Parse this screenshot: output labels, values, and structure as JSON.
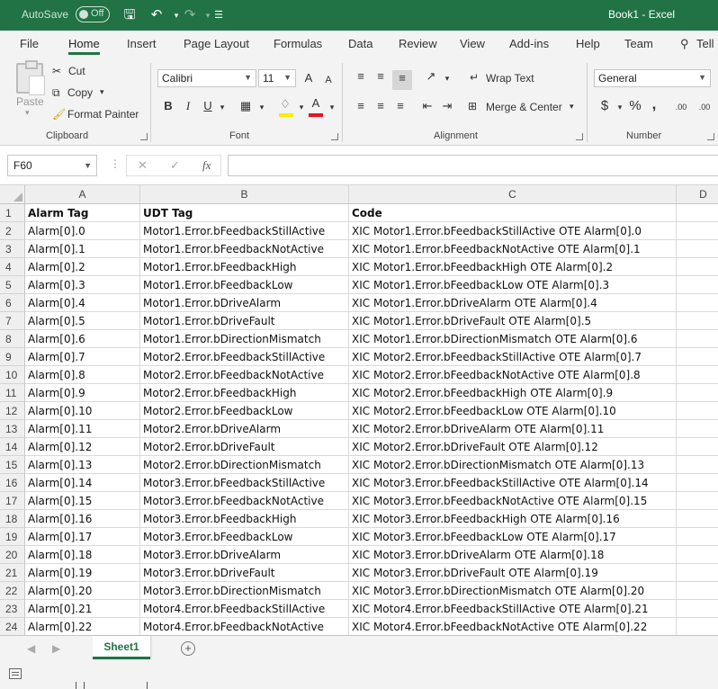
{
  "titlebar": {
    "autosave_label": "AutoSave",
    "autosave_state": "Off",
    "document_title": "Book1  -  Excel"
  },
  "tabs": [
    "File",
    "Home",
    "Insert",
    "Page Layout",
    "Formulas",
    "Data",
    "Review",
    "View",
    "Add-ins",
    "Help",
    "Team",
    "Tell"
  ],
  "active_tab": "Home",
  "ribbon": {
    "clipboard": {
      "paste": "Paste",
      "cut": "Cut",
      "copy": "Copy",
      "format_painter": "Format Painter",
      "group_label": "Clipboard"
    },
    "font": {
      "font_name": "Calibri",
      "font_size": "11",
      "grow": "A",
      "shrink": "A",
      "bold": "B",
      "italic": "I",
      "underline": "U",
      "group_label": "Font"
    },
    "alignment": {
      "wrap_text": "Wrap Text",
      "merge_center": "Merge & Center",
      "group_label": "Alignment"
    },
    "number": {
      "format": "General",
      "currency": "$",
      "percent": "%",
      "comma": ",",
      "inc_decimal": ".00",
      "dec_decimal": ".00",
      "group_label": "Number"
    }
  },
  "formula_bar": {
    "name_box": "F60",
    "fx": "fx",
    "formula": ""
  },
  "columns": [
    "A",
    "B",
    "C",
    "D"
  ],
  "rows": [
    {
      "num": "1",
      "a": "Alarm Tag",
      "b": "UDT Tag",
      "c": "Code"
    },
    {
      "num": "2",
      "a": "Alarm[0].0",
      "b": "Motor1.Error.bFeedbackStillActive",
      "c": "XIC Motor1.Error.bFeedbackStillActive OTE Alarm[0].0"
    },
    {
      "num": "3",
      "a": "Alarm[0].1",
      "b": "Motor1.Error.bFeedbackNotActive",
      "c": "XIC Motor1.Error.bFeedbackNotActive OTE Alarm[0].1"
    },
    {
      "num": "4",
      "a": "Alarm[0].2",
      "b": "Motor1.Error.bFeedbackHigh",
      "c": "XIC Motor1.Error.bFeedbackHigh OTE Alarm[0].2"
    },
    {
      "num": "5",
      "a": "Alarm[0].3",
      "b": "Motor1.Error.bFeedbackLow",
      "c": "XIC Motor1.Error.bFeedbackLow OTE Alarm[0].3"
    },
    {
      "num": "6",
      "a": "Alarm[0].4",
      "b": "Motor1.Error.bDriveAlarm",
      "c": "XIC Motor1.Error.bDriveAlarm OTE Alarm[0].4"
    },
    {
      "num": "7",
      "a": "Alarm[0].5",
      "b": "Motor1.Error.bDriveFault",
      "c": "XIC Motor1.Error.bDriveFault OTE Alarm[0].5"
    },
    {
      "num": "8",
      "a": "Alarm[0].6",
      "b": "Motor1.Error.bDirectionMismatch",
      "c": "XIC Motor1.Error.bDirectionMismatch OTE Alarm[0].6"
    },
    {
      "num": "9",
      "a": "Alarm[0].7",
      "b": "Motor2.Error.bFeedbackStillActive",
      "c": "XIC Motor2.Error.bFeedbackStillActive OTE Alarm[0].7"
    },
    {
      "num": "10",
      "a": "Alarm[0].8",
      "b": "Motor2.Error.bFeedbackNotActive",
      "c": "XIC Motor2.Error.bFeedbackNotActive OTE Alarm[0].8"
    },
    {
      "num": "11",
      "a": "Alarm[0].9",
      "b": "Motor2.Error.bFeedbackHigh",
      "c": "XIC Motor2.Error.bFeedbackHigh OTE Alarm[0].9"
    },
    {
      "num": "12",
      "a": "Alarm[0].10",
      "b": "Motor2.Error.bFeedbackLow",
      "c": "XIC Motor2.Error.bFeedbackLow OTE Alarm[0].10"
    },
    {
      "num": "13",
      "a": "Alarm[0].11",
      "b": "Motor2.Error.bDriveAlarm",
      "c": "XIC Motor2.Error.bDriveAlarm OTE Alarm[0].11"
    },
    {
      "num": "14",
      "a": "Alarm[0].12",
      "b": "Motor2.Error.bDriveFault",
      "c": "XIC Motor2.Error.bDriveFault OTE Alarm[0].12"
    },
    {
      "num": "15",
      "a": "Alarm[0].13",
      "b": "Motor2.Error.bDirectionMismatch",
      "c": "XIC Motor2.Error.bDirectionMismatch OTE Alarm[0].13"
    },
    {
      "num": "16",
      "a": "Alarm[0].14",
      "b": "Motor3.Error.bFeedbackStillActive",
      "c": "XIC Motor3.Error.bFeedbackStillActive OTE Alarm[0].14"
    },
    {
      "num": "17",
      "a": "Alarm[0].15",
      "b": "Motor3.Error.bFeedbackNotActive",
      "c": "XIC Motor3.Error.bFeedbackNotActive OTE Alarm[0].15"
    },
    {
      "num": "18",
      "a": "Alarm[0].16",
      "b": "Motor3.Error.bFeedbackHigh",
      "c": "XIC Motor3.Error.bFeedbackHigh OTE Alarm[0].16"
    },
    {
      "num": "19",
      "a": "Alarm[0].17",
      "b": "Motor3.Error.bFeedbackLow",
      "c": "XIC Motor3.Error.bFeedbackLow OTE Alarm[0].17"
    },
    {
      "num": "20",
      "a": "Alarm[0].18",
      "b": "Motor3.Error.bDriveAlarm",
      "c": "XIC Motor3.Error.bDriveAlarm OTE Alarm[0].18"
    },
    {
      "num": "21",
      "a": "Alarm[0].19",
      "b": "Motor3.Error.bDriveFault",
      "c": "XIC Motor3.Error.bDriveFault OTE Alarm[0].19"
    },
    {
      "num": "22",
      "a": "Alarm[0].20",
      "b": "Motor3.Error.bDirectionMismatch",
      "c": "XIC Motor3.Error.bDirectionMismatch OTE Alarm[0].20"
    },
    {
      "num": "23",
      "a": "Alarm[0].21",
      "b": "Motor4.Error.bFeedbackStillActive",
      "c": "XIC Motor4.Error.bFeedbackStillActive OTE Alarm[0].21"
    },
    {
      "num": "24",
      "a": "Alarm[0].22",
      "b": "Motor4.Error.bFeedbackNotActive",
      "c": "XIC Motor4.Error.bFeedbackNotActive OTE Alarm[0].22"
    }
  ],
  "sheets": [
    "Sheet1"
  ],
  "colors": {
    "brand": "#217346",
    "font_color_bar": "#e81123",
    "highlight_bar": "#ffeb00"
  }
}
